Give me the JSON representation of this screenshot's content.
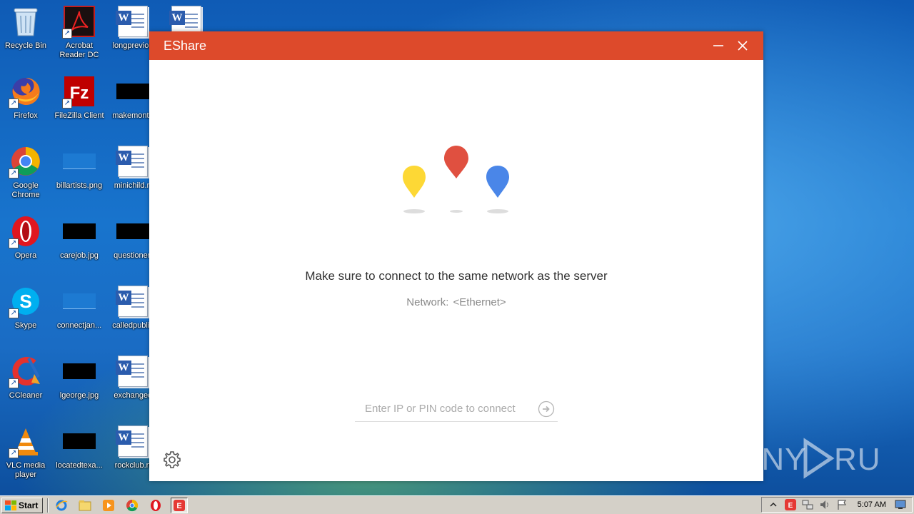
{
  "desktop": {
    "icons": [
      {
        "label": "Recycle Bin"
      },
      {
        "label": "Acrobat Reader DC"
      },
      {
        "label": "longpreviou"
      },
      {
        "label": ""
      },
      {
        "label": "Firefox"
      },
      {
        "label": "FileZilla Client"
      },
      {
        "label": "makemonth"
      },
      {
        "label": "Google Chrome"
      },
      {
        "label": "billartists.png"
      },
      {
        "label": "minichild.rt"
      },
      {
        "label": "Opera"
      },
      {
        "label": "carejob.jpg"
      },
      {
        "label": "questionen"
      },
      {
        "label": "Skype"
      },
      {
        "label": "connectjan..."
      },
      {
        "label": "calledpublic"
      },
      {
        "label": "CCleaner"
      },
      {
        "label": "lgeorge.jpg"
      },
      {
        "label": "exchangec"
      },
      {
        "label": "VLC media player"
      },
      {
        "label": "locatedtexa..."
      },
      {
        "label": "rockclub.rt"
      }
    ]
  },
  "window": {
    "title": "EShare",
    "message": "Make sure to connect to the same network as the server",
    "network_label": "Network:",
    "network_value": "<Ethernet>",
    "connect_placeholder": "Enter IP or PIN code to connect",
    "connect_value": "",
    "colors": {
      "titlebar": "#dd4a2b",
      "yellow": "#fdd835",
      "red": "#e05040",
      "blue": "#4a86e8"
    }
  },
  "watermark": {
    "text": "ANY RUN"
  },
  "taskbar": {
    "start_label": "Start",
    "clock": "5:07 AM"
  }
}
